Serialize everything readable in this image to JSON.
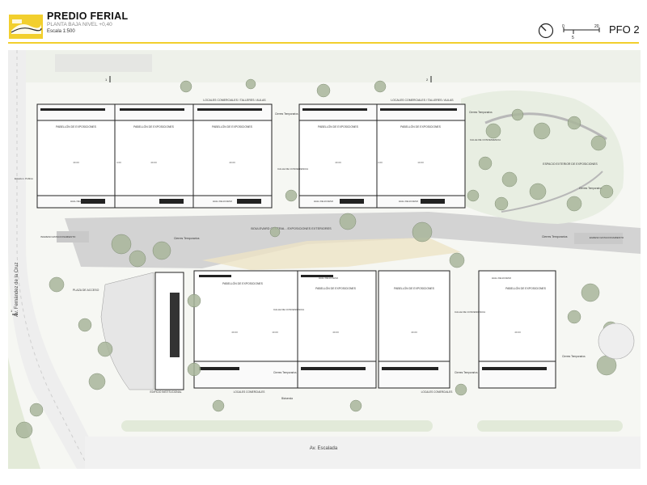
{
  "header": {
    "title": "PREDIO FERIAL",
    "subtitle": "PLANTA BAJA NIVEL +0,40",
    "scale": "Escala 1:500",
    "sheet_code": "PFO 2",
    "scalebar_labels": [
      "0",
      "5",
      "20"
    ]
  },
  "colors": {
    "accent": "#f2cf2d",
    "boulevard": "#d3d3d3",
    "sand": "#ede4c6",
    "grass": "#e8eee2",
    "tree": "#a9b69b",
    "tree_dark": "#6f7f63"
  },
  "streets": {
    "left": "Av. Fernández de la Cruz",
    "bottom": "Av. Escalada"
  },
  "plan": {
    "pabellon": "PABELLÓN DE EXPOSICIONES",
    "locales_norte_1": "LOCALES COMERCIALES / TALLERES / AULAS",
    "locales_norte_2": "LOCALES COMERCIALES / TALLERES / AULAS",
    "cierres_1": "Cierres Temporarios",
    "cierres_2": "Cierres Temporarios",
    "cierres_3": "Cierres Temporarios",
    "cierres_4": "Cierres Temporarios",
    "cierres_5": "Cierres Temporarios",
    "cierres_6": "Cierres Temporarios",
    "cierres_7": "Cierres Temporarios",
    "cierres_8": "Cierres Temporarios",
    "calle_1": "CALLE DE CONVENIENCIA",
    "calle_2": "CALLE DE CONVENIENCIA",
    "calle_3": "CALLE DE CONVENIENCIA",
    "calle_4": "CALLE DE CONVENIENCIA",
    "espacio_exterior": "ESPACIO EXTERIOR DE EXPOSICIONES",
    "estacionamiento": "Estacion. Público",
    "ingreso_izq": "INGRESO ESTACIONAMIENTO",
    "egreso_der": "EGRESO ESTACIONAMIENTO",
    "boulevard": "BOULEVARD CENTRAL - EXPOSICIONES EXTERIORES",
    "hall": "HALL DE ACCESO",
    "plaza": "PLAZA DE ACCESO",
    "edificio": "EDIFICIO INSTITUCIONAL",
    "locales_sur_1": "LOCALES COMERCIALES",
    "locales_sur_2": "LOCALES COMERCIALES",
    "bicisenda": "Bicisenda",
    "dim_main": "40.00",
    "dim_small": "4.00",
    "dim_mid": "10.00",
    "mark_1": "1",
    "mark_2": "2",
    "mark_3": "1"
  }
}
